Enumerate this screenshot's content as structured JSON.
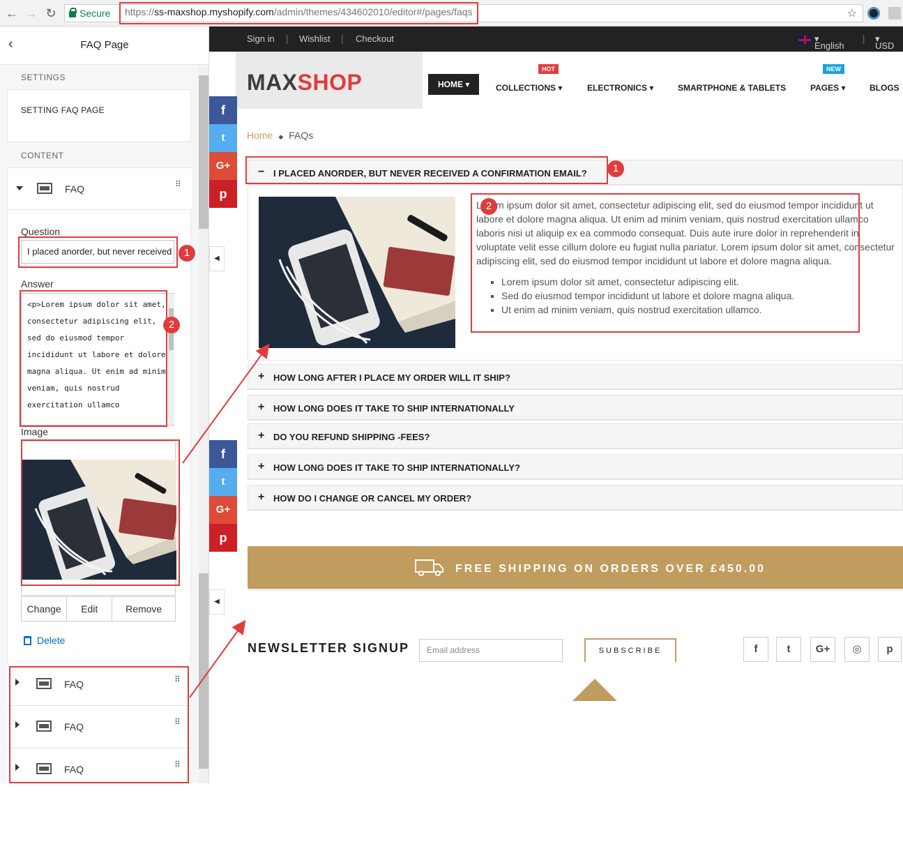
{
  "browser": {
    "secure_label": "Secure",
    "url_scheme": "https://",
    "url_domain": "ss-maxshop.myshopify.com",
    "url_path": "/admin/themes/434602010/editor#/pages/faqs"
  },
  "editor": {
    "title": "FAQ Page",
    "settings_label": "SETTINGS",
    "settings_item": "SETTING FAQ PAGE",
    "content_label": "CONTENT",
    "block_label": "FAQ",
    "question_label": "Question",
    "question_value": "I placed anorder, but never received a confirmation email?",
    "answer_label": "Answer",
    "answer_value": "<p>Lorem ipsum dolor sit amet, consectetur adipiscing elit, sed do eiusmod tempor incididunt ut labore et dolore magna aliqua. Ut enim ad minim veniam, quis nostrud exercitation ullamco",
    "image_label": "Image",
    "change_label": "Change",
    "edit_label": "Edit",
    "remove_label": "Remove",
    "delete_label": "Delete",
    "collapsed_blocks": [
      "FAQ",
      "FAQ",
      "FAQ"
    ]
  },
  "annotations": [
    "1",
    "2",
    "1",
    "2"
  ],
  "store": {
    "topbar": {
      "sign_in": "Sign in",
      "wishlist": "Wishlist",
      "checkout": "Checkout",
      "language": "English",
      "currency": "USD"
    },
    "logo_main": "MAX",
    "logo_accent": "SHOP",
    "menu": {
      "home": "HOME",
      "collections": "COLLECTIONS",
      "electronics": "ELECTRONICS",
      "smartphone": "SMARTPHONE & TABLETS",
      "pages": "PAGES",
      "blogs": "BLOGS",
      "hot_tag": "HOT",
      "new_tag": "NEW"
    },
    "breadcrumb": {
      "home": "Home",
      "current": "FAQs"
    },
    "faq": {
      "open_question": "I PLACED ANORDER, BUT NEVER RECEIVED A CONFIRMATION EMAIL?",
      "answer_paragraph": "Lorem ipsum dolor sit amet, consectetur adipiscing elit, sed do eiusmod tempor incididunt ut labore et dolore magna aliqua. Ut enim ad minim veniam, quis nostrud exercitation ullamco laboris nisi ut aliquip ex ea commodo consequat. Duis aute irure dolor in reprehenderit in voluptate velit esse cillum dolore eu fugiat nulla pariatur. Lorem ipsum dolor sit amet, consectetur adipiscing elit, sed do eiusmod tempor incididunt ut labore et dolore magna aliqua.",
      "answer_bullets": [
        "Lorem ipsum dolor sit amet, consectetur adipiscing elit.",
        "Sed do eiusmod tempor incididunt ut labore et dolore magna aliqua.",
        "Ut enim ad minim veniam, quis nostrud exercitation ullamco."
      ],
      "closed_questions": [
        "HOW LONG AFTER I PLACE MY ORDER WILL IT SHIP?",
        "HOW LONG DOES IT TAKE TO SHIP INTERNATIONALLY",
        "DO YOU REFUND SHIPPING -FEES?",
        "HOW LONG DOES IT TAKE TO SHIP INTERNATIONALLY?",
        "HOW DO I CHANGE OR CANCEL MY ORDER?"
      ]
    },
    "shipping_banner": "FREE SHIPPING ON ORDERS OVER £450.00",
    "newsletter": {
      "title": "NEWSLETTER SIGNUP",
      "placeholder": "Email address",
      "button": "SUBSCRIBE"
    },
    "social_glyphs": {
      "facebook": "f",
      "twitter": "t",
      "google": "G+",
      "pinterest": "p",
      "dribbble": "◎"
    }
  },
  "colors": {
    "accent": "#c09c5f",
    "annotation": "#e03c3c",
    "link": "#006fbb"
  }
}
